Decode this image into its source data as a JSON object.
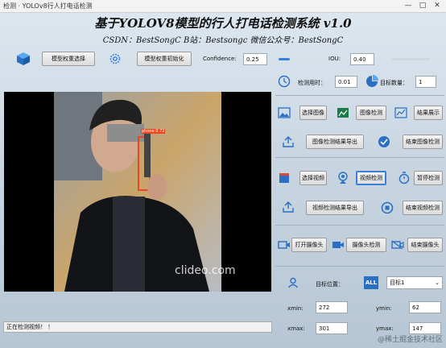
{
  "window": {
    "title": "检测 · YOLOv8行人打电话检测",
    "minimize": "—",
    "maximize": "□",
    "close": "✕"
  },
  "header": {
    "title": "基于YOLOV8模型的行人打电话检测系统 v1.0",
    "subtitle": "CSDN：BestSongC   B站：Bestsongc   微信公众号：BestSongC"
  },
  "toolbar": {
    "model_select_label": "模型权重选择",
    "model_init_label": "模型权重初始化",
    "confidence_label": "Confidence:",
    "confidence_value": "0.25",
    "iou_label": "IOU:",
    "iou_value": "0.40"
  },
  "stats": {
    "time_label": "检测用时：",
    "time_value": "0.01",
    "count_label": "目标数量：",
    "count_value": "1"
  },
  "image_section": {
    "select_label": "选择图像",
    "detect_label": "图像检测",
    "show_label": "结果展示",
    "export_label": "图像检测结果导出",
    "end_label": "结束图像检测"
  },
  "video_section": {
    "select_label": "选择视频",
    "detect_label": "视频检测",
    "pause_label": "暂停检测",
    "export_label": "视频检测结果导出",
    "end_label": "结束视频检测"
  },
  "camera_section": {
    "open_label": "打开摄像头",
    "detect_label": "摄像头检测",
    "end_label": "结束摄像头"
  },
  "target": {
    "label": "目标位置：",
    "all_badge": "ALL",
    "selected": "目标1",
    "xmin_label": "xmin:",
    "xmin_value": "272",
    "ymin_label": "ymin:",
    "ymin_value": "62",
    "xmax_label": "xmax:",
    "xmax_value": "301",
    "ymax_label": "ymax:",
    "ymax_value": "147"
  },
  "video": {
    "detection_label": "phone 0.72",
    "watermark": "clideo.com"
  },
  "status": {
    "text": "正在检测视频！ ！"
  },
  "footer": {
    "watermark": "@稀土掘金技术社区"
  },
  "colors": {
    "accent": "#3b7fd9",
    "detection_box": "#e8481e"
  }
}
